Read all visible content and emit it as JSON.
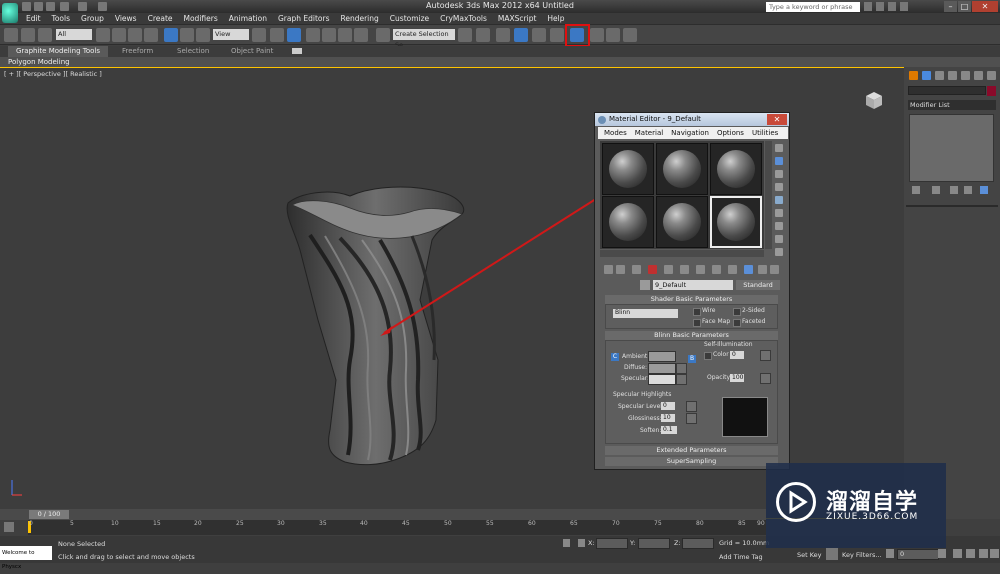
{
  "window": {
    "title": "Autodesk 3ds Max  2012 x64      Untitled",
    "search_placeholder": "Type a keyword or phrase",
    "minimize": "–",
    "maximize": "□",
    "close": "✕"
  },
  "menu": [
    "Edit",
    "Tools",
    "Group",
    "Views",
    "Create",
    "Modifiers",
    "Animation",
    "Graph Editors",
    "Rendering",
    "Customize",
    "CryMaxTools",
    "MAXScript",
    "Help"
  ],
  "toolbar": {
    "selection_filter": "All",
    "reference_coord": "View",
    "selection_set": "Create Selection Se"
  },
  "ribbon": {
    "tabs": [
      "Graphite Modeling Tools",
      "Freeform",
      "Selection",
      "Object Paint"
    ],
    "panel": "Polygon Modeling"
  },
  "viewport": {
    "label": "[ + ][ Perspective ][ Realistic ]"
  },
  "command_panel": {
    "modifier_list": "Modifier List"
  },
  "material_editor": {
    "title": "Material Editor - 9_Default",
    "menu": [
      "Modes",
      "Material",
      "Navigation",
      "Options",
      "Utilities"
    ],
    "material_name": "9_Default",
    "material_type": "Standard",
    "shader_basic": {
      "header": "Shader Basic Parameters",
      "shader": "Blinn",
      "wire": "Wire",
      "two_sided": "2-Sided",
      "face_map": "Face Map",
      "faceted": "Faceted"
    },
    "blinn_basic": {
      "header": "Blinn Basic Parameters",
      "self_illum_title": "Self-Illumination",
      "color_label": "Color",
      "color_value": "0",
      "ambient": "Ambient:",
      "diffuse": "Diffuse:",
      "specular": "Specular:",
      "lock_c": "C",
      "lock_b": "B",
      "opacity_label": "Opacity:",
      "opacity_value": "100"
    },
    "specular_highlights": {
      "title": "Specular Highlights",
      "level_label": "Specular Level:",
      "level_value": "0",
      "gloss_label": "Glossiness:",
      "gloss_value": "10",
      "soften_label": "Soften:",
      "soften_value": "0.1"
    },
    "extended_parameters": "Extended Parameters",
    "supersampling": "SuperSampling"
  },
  "timeline": {
    "frame": "0 / 100",
    "ticks": [
      "0",
      "5",
      "10",
      "15",
      "20",
      "25",
      "30",
      "35",
      "40",
      "45",
      "50",
      "55",
      "60",
      "65",
      "70",
      "75",
      "80",
      "85",
      "90"
    ]
  },
  "status": {
    "maxscript": "Welcome to Physcx",
    "selection": "None Selected",
    "prompt": "Click and drag to select and move objects",
    "x_label": "X:",
    "y_label": "Y:",
    "z_label": "Z:",
    "grid": "Grid = 10.0mm",
    "add_time_tag": "Add Time Tag",
    "set_key": "Set Key",
    "key_filters": "Key Filters...",
    "frame_field": "0"
  },
  "watermark": {
    "title": "溜溜自学",
    "url": "ZIXUE.3D66.COM"
  },
  "colors": {
    "highlight_box": "#e01010",
    "viewport_border": "#fdc300",
    "arrow": "#d01818"
  }
}
